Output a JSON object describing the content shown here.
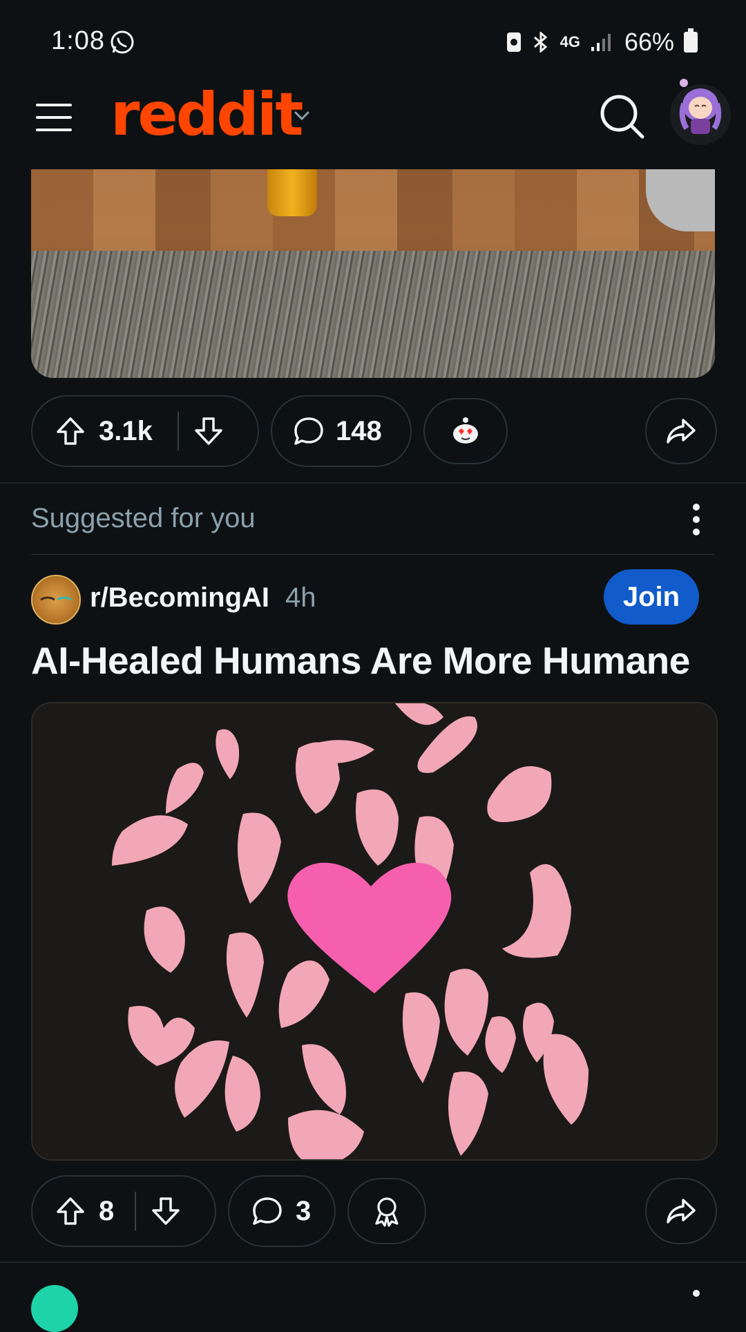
{
  "status_bar": {
    "time": "1:08",
    "network": "4G",
    "battery": "66%"
  },
  "header": {
    "logo": "reddit"
  },
  "post1": {
    "upvotes": "3.1k",
    "comments": "148"
  },
  "feed": {
    "suggested_label": "Suggested for you"
  },
  "post2": {
    "subreddit": "r/BecomingAI",
    "age": "4h",
    "join_label": "Join",
    "title": "AI-Healed Humans Are More Humane",
    "upvotes": "8",
    "comments": "3"
  },
  "colors": {
    "brand": "#ff4500",
    "join": "#115bca",
    "background": "#0e1113",
    "muted": "#8ba2ad"
  },
  "icons": [
    "menu-icon",
    "chevron-down-icon",
    "search-icon",
    "upvote-icon",
    "downvote-icon",
    "comment-icon",
    "award-icon",
    "share-icon",
    "more-options-icon"
  ]
}
